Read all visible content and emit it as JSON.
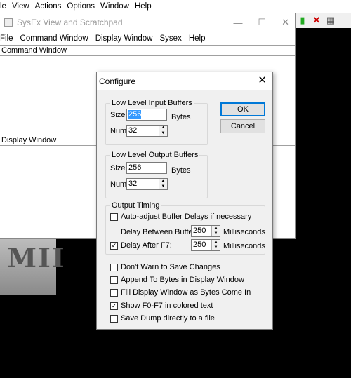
{
  "bg_app": {
    "menu": [
      "le",
      "View",
      "Actions",
      "Options",
      "Window",
      "Help"
    ],
    "toolbar_icons": [
      "traffic-light-icon",
      "red-x-icon",
      "grid-icon"
    ],
    "logo_text": "MII"
  },
  "sysex_window": {
    "title": "SysEx View and Scratchpad",
    "menu": [
      "File",
      "Command Window",
      "Display Window",
      "Sysex",
      "Help"
    ],
    "command_pane_label": "Command Window",
    "display_pane_label": "Display Window"
  },
  "dialog": {
    "title": "Configure",
    "input_buffers": {
      "title": "Low Level Input Buffers",
      "size_label": "Size",
      "size_value": "256",
      "size_unit": "Bytes",
      "num_label": "Num",
      "num_value": "32"
    },
    "output_buffers": {
      "title": "Low Level Output Buffers",
      "size_label": "Size",
      "size_value": "256",
      "size_unit": "Bytes",
      "num_label": "Num",
      "num_value": "32"
    },
    "timing": {
      "title": "Output Timing",
      "auto_adjust_label": "Auto-adjust Buffer Delays if necessary",
      "auto_adjust_checked": false,
      "between_label": "Delay Between Buffers:",
      "between_value": "250",
      "between_unit": "Milliseconds",
      "after_label": "Delay After F7:",
      "after_checked": true,
      "after_value": "250",
      "after_unit": "Milliseconds"
    },
    "options": [
      {
        "label": "Don't Warn to Save Changes",
        "checked": false
      },
      {
        "label": "Append To Bytes in Display Window",
        "checked": false
      },
      {
        "label": "Fill Display Window as Bytes Come In",
        "checked": false
      },
      {
        "label": "Show F0-F7 in colored text",
        "checked": true
      },
      {
        "label": "Save Dump directly to a file",
        "checked": false
      }
    ],
    "ok_label": "OK",
    "cancel_label": "Cancel"
  }
}
